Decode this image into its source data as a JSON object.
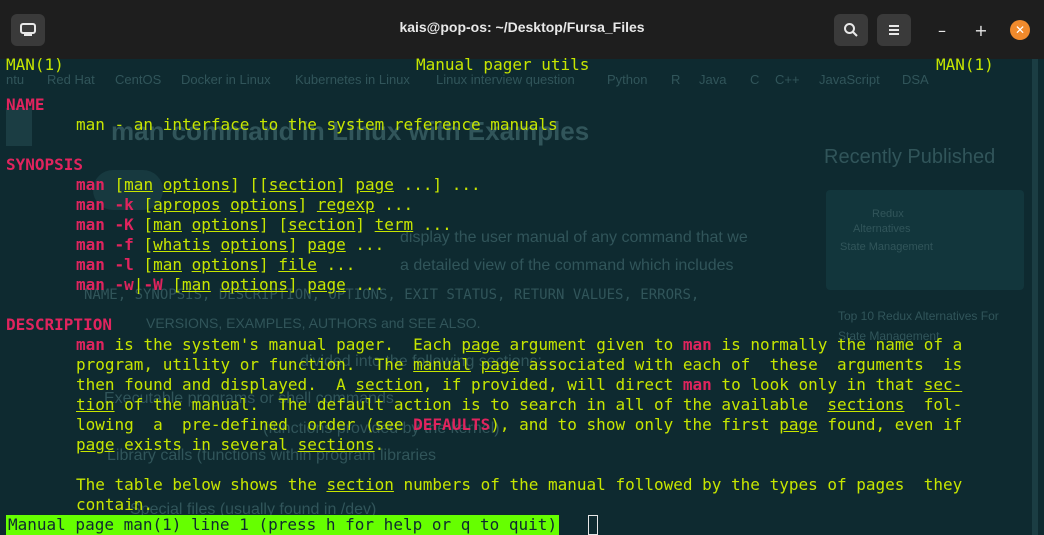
{
  "window": {
    "title": "kais@pop-os: ~/Desktop/Fursa_Files"
  },
  "icons": {
    "new_tab": "new-tab-icon",
    "search": "search-icon",
    "menu": "hamburger-menu-icon",
    "minimize": "minimize-icon",
    "maximize": "maximize-icon",
    "close": "close-icon"
  },
  "background_page": {
    "nav": [
      "ntu",
      "Red Hat",
      "CentOS",
      "Docker in Linux",
      "Kubernetes in Linux",
      "Linux interview question",
      "Python",
      "R",
      "Java",
      "C",
      "C++",
      "JavaScript",
      "DSA"
    ],
    "heading": "man command in Linux with Examples",
    "sidebar_title": "Recently Published",
    "card_badge_1": "Redux",
    "card_badge_2": "Alternatives",
    "card_badge_3": "State Management",
    "card_text": "Top 10 Redux Alternatives For State Management",
    "body_1": "display the user manual of any command that we",
    "body_2": "a detailed view of the command which includes",
    "body_3": "NAME, SYNOPSIS, DESCRIPTION, OPTIONS, EXIT STATUS, RETURN VALUES, ERRORS,",
    "body_4": "VERSIONS, EXAMPLES, AUTHORS and SEE ALSO.",
    "body_5": "divided into the following sections:",
    "body_6": "Executable programs or shell commands",
    "body_7": "(functions provided by the kernel)",
    "body_8": "Library calls (functions within program libraries",
    "body_9": "Special files (usually found in /dev)"
  },
  "man": {
    "header_left": "MAN(1)",
    "header_center": "Manual pager utils",
    "header_right": "MAN(1)",
    "name_heading": "NAME",
    "name_text": "man - an interface to the system reference manuals",
    "synopsis_heading": "SYNOPSIS",
    "description_heading": "DESCRIPTION",
    "status": "Manual page man(1) line 1 (press h for help or q to quit)"
  },
  "colors": {
    "background": "#0e2a30",
    "text": "#c7e600",
    "bold": "#e0245e",
    "status_bg": "#66ff00",
    "close_button": "#f08a2c"
  }
}
